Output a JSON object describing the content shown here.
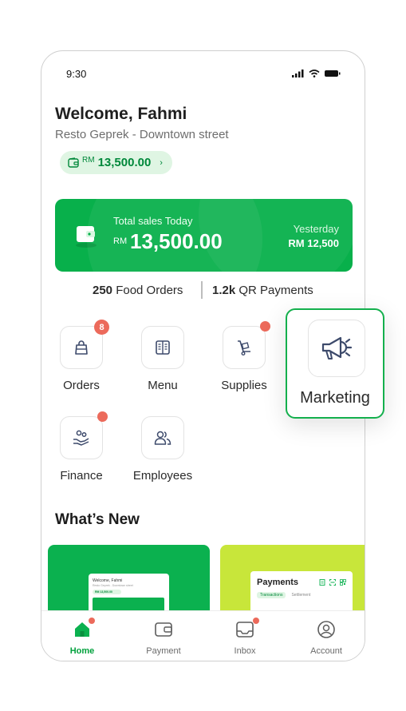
{
  "status": {
    "time": "9:30",
    "icons": [
      "signal-icon",
      "wifi-icon",
      "battery-icon"
    ]
  },
  "header": {
    "welcome": "Welcome, Fahmi",
    "subtitle": "Resto Geprek - Downtown street",
    "balance": {
      "currency": "RM",
      "amount": "13,500.00",
      "icon": "wallet-icon"
    }
  },
  "sales_card": {
    "label": "Total sales Today",
    "currency": "RM",
    "amount": "13,500.00",
    "yesterday_label": "Yesterday",
    "yesterday_amount": "RM 12,500"
  },
  "stats": [
    {
      "value": "250",
      "label": "Food Orders"
    },
    {
      "value": "1.2k",
      "label": "QR Payments"
    }
  ],
  "menu": [
    {
      "label": "Orders",
      "icon": "shopping-bag-icon",
      "badge": "8"
    },
    {
      "label": "Menu",
      "icon": "menu-book-icon"
    },
    {
      "label": "Supplies",
      "icon": "hand-truck-icon"
    },
    {
      "label": "Finance",
      "icon": "finance-icon"
    },
    {
      "label": "Employees",
      "icon": "employees-icon"
    }
  ],
  "marketing": {
    "label": "Marketing",
    "icon": "megaphone-icon"
  },
  "whats_new": {
    "title": "What’s New",
    "promo1": {
      "welcome": "Welcome, Fahmi",
      "subtitle": "Resto Geprek - Downtown street",
      "balance": "RM 13,500.00"
    },
    "promo2": {
      "title": "Payments",
      "tabs": [
        "Transactions",
        "Settlement"
      ]
    }
  },
  "bottom_nav": [
    {
      "label": "Home",
      "icon": "home-icon",
      "active": true
    },
    {
      "label": "Payment",
      "icon": "wallet-icon"
    },
    {
      "label": "Inbox",
      "icon": "inbox-icon"
    },
    {
      "label": "Account",
      "icon": "account-icon"
    }
  ],
  "colors": {
    "brand": "#08b04b",
    "brand_dark": "#00883a",
    "badge": "#ec6a5b",
    "accent_lime": "#c8e63a"
  }
}
